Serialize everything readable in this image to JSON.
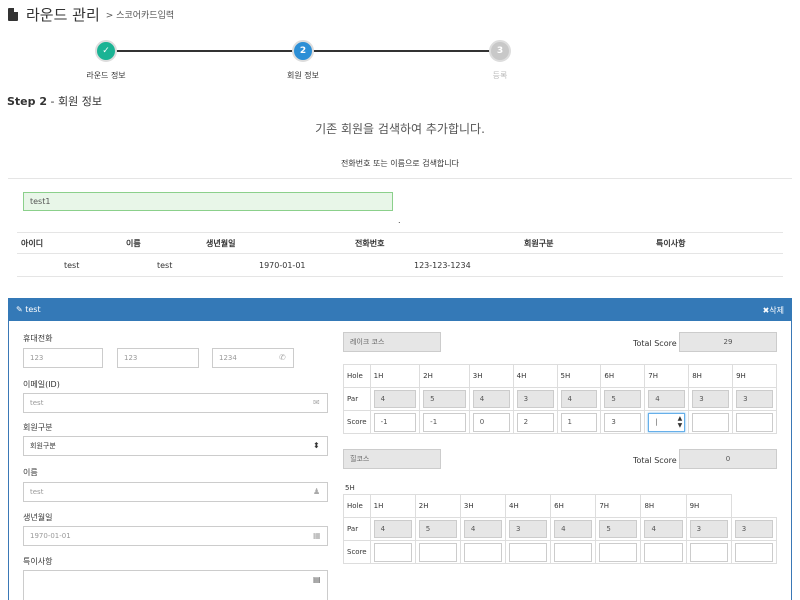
{
  "page": {
    "title": "라운드 관리",
    "breadcrumb": "> 스코어카드입력"
  },
  "wizard": {
    "steps": [
      {
        "num": "✓",
        "label": "라운드 정보",
        "state": "done",
        "color": "#1ab394"
      },
      {
        "num": "2",
        "label": "회원 정보",
        "state": "active",
        "color": "#2c8fd6"
      },
      {
        "num": "3",
        "label": "등록",
        "state": "pending",
        "color": "#c8c8c8"
      }
    ]
  },
  "step_header": {
    "step": "Step 2",
    "sep": " - ",
    "name": "회원 정보"
  },
  "headline": "기존 회원을 검색하여 추가합니다.",
  "hint": "전화번호 또는 이름으로 검색합니다",
  "search": {
    "value": "test1",
    "dot": "."
  },
  "results": {
    "headers": [
      "아이디",
      "이름",
      "생년월일",
      "전화번호",
      "회원구분",
      "특이사항"
    ],
    "rows": [
      {
        "id": "test",
        "name": "test",
        "birth": "1970-01-01",
        "phone": "123-123-1234",
        "type": "",
        "note": ""
      }
    ]
  },
  "panel": {
    "title": "test",
    "delete_label": "삭제",
    "form": {
      "phone_label": "휴대전화",
      "phone": [
        "123",
        "123",
        "1234"
      ],
      "email_label": "이메일(ID)",
      "email": "test",
      "type_label": "회원구분",
      "type_value": "회원구분",
      "name_label": "이름",
      "name": "test",
      "birth_label": "생년월일",
      "birth": "1970-01-01",
      "note_label": "특이사항"
    },
    "course1": {
      "name": "레이크 코스",
      "total_label": "Total Score",
      "total": "29",
      "hole_label": "Hole",
      "par_label": "Par",
      "score_label": "Score",
      "holes": [
        "1H",
        "2H",
        "3H",
        "4H",
        "5H",
        "6H",
        "7H",
        "8H",
        "9H"
      ],
      "par": [
        "4",
        "5",
        "4",
        "3",
        "4",
        "5",
        "4",
        "3",
        "3"
      ],
      "score": [
        "-1",
        "-1",
        "0",
        "2",
        "1",
        "3",
        "",
        "",
        ""
      ]
    },
    "course2": {
      "name": "힐코스",
      "total_label": "Total Score",
      "total": "0",
      "extra": "5H",
      "hole_label": "Hole",
      "par_label": "Par",
      "score_label": "Score",
      "holes": [
        "1H",
        "2H",
        "3H",
        "4H",
        "6H",
        "7H",
        "8H",
        "9H"
      ],
      "par": [
        "4",
        "5",
        "4",
        "3",
        "4",
        "5",
        "4",
        "3",
        "3"
      ],
      "score": [
        "",
        "",
        "",
        "",
        "",
        "",
        "",
        "",
        ""
      ]
    }
  }
}
